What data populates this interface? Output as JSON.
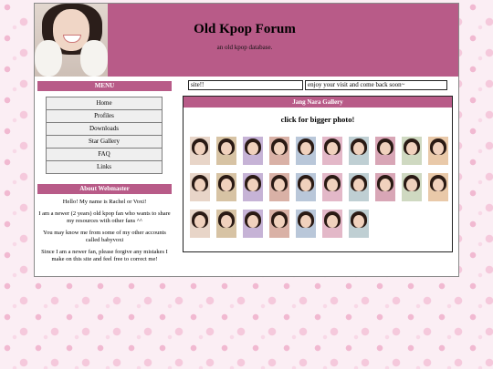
{
  "header": {
    "title": "Old Kpop Forum",
    "subtitle": "an old kpop database."
  },
  "marquee": {
    "left": "site!!",
    "right": "enjoy your visit and come back soon~"
  },
  "sidebar": {
    "menu_heading": "MENU",
    "menu_items": [
      "Home",
      "Profiles",
      "Downloads",
      "Star Gallery",
      "FAQ",
      "Links"
    ],
    "about_heading": "About Webmaster",
    "about_paragraphs": [
      "Hello! My name is Rachel or Voxi!",
      "I am a newer (2 years) old kpop fan who wants to share my resources with other fans ^^",
      "You may know me from some of my other accounts called babyvoxi",
      "Since I am a newer fan, please forgive any mistakes I make on this site and feel free to correct me!"
    ]
  },
  "gallery": {
    "heading": "Jang Nara Gallery",
    "note": "click for bigger photo!",
    "thumb_count": 27
  },
  "colors": {
    "accent": "#b85b88",
    "page_bg": "#fbeef4"
  }
}
